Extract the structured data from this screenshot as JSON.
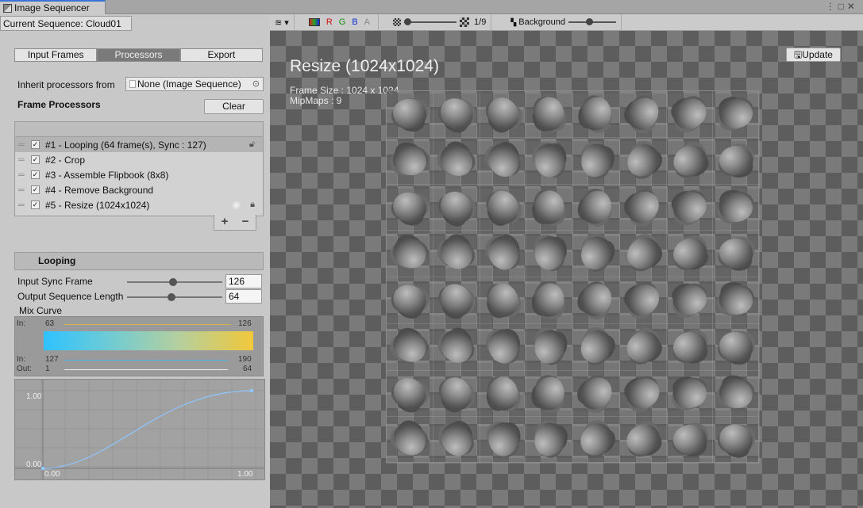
{
  "window": {
    "title": "Image Sequencer"
  },
  "sequence": {
    "label": "Current Sequence: Cloud01"
  },
  "mode_tabs": [
    {
      "label": "Input Frames"
    },
    {
      "label": "Processors"
    },
    {
      "label": "Export"
    }
  ],
  "mode_active": "Processors",
  "inherit": {
    "label": "Inherit processors from",
    "value": "None (Image Sequence)"
  },
  "frame_processors": {
    "title": "Frame Processors",
    "clear_label": "Clear",
    "items": [
      {
        "label": "#1 - Looping (64 frame(s), Sync : 127)",
        "checked": true
      },
      {
        "label": "#2 - Crop",
        "checked": true
      },
      {
        "label": "#3 - Assemble Flipbook (8x8)",
        "checked": true
      },
      {
        "label": "#4 - Remove Background",
        "checked": true
      },
      {
        "label": "#5 - Resize (1024x1024)",
        "checked": true
      }
    ],
    "add_label": "+",
    "remove_label": "−"
  },
  "looping": {
    "title": "Looping",
    "input_sync_label": "Input Sync Frame",
    "input_sync_value": "126",
    "input_sync_slider": 0.48,
    "output_length_label": "Output Sequence Length",
    "output_length_value": "64",
    "output_length_slider": 0.48,
    "mix_curve_label": "Mix Curve",
    "mix": {
      "in1_label": "In:",
      "in1_from": "63",
      "in1_to": "126",
      "in2_label": "In:",
      "in2_from": "127",
      "in2_to": "190",
      "out_label": "Out:",
      "out_from": "1",
      "out_to": "64"
    },
    "curve": {
      "y_max": "1.00",
      "y_min": "0.00",
      "x_min": "0.00",
      "x_max": "1.00"
    }
  },
  "toolbar": {
    "channels": [
      "R",
      "G",
      "B",
      "A"
    ],
    "channel_colors": [
      "#d01010",
      "#109010",
      "#1030d0",
      "#888888"
    ],
    "mip_label": "1/9",
    "background_label": "Background"
  },
  "preview": {
    "title": "Resize (1024x1024)",
    "frame_size": "Frame Size : 1024 x 1024",
    "mipmaps": "MipMaps : 9",
    "update_label": "Update",
    "grid_cols": 8,
    "grid_rows": 8
  }
}
